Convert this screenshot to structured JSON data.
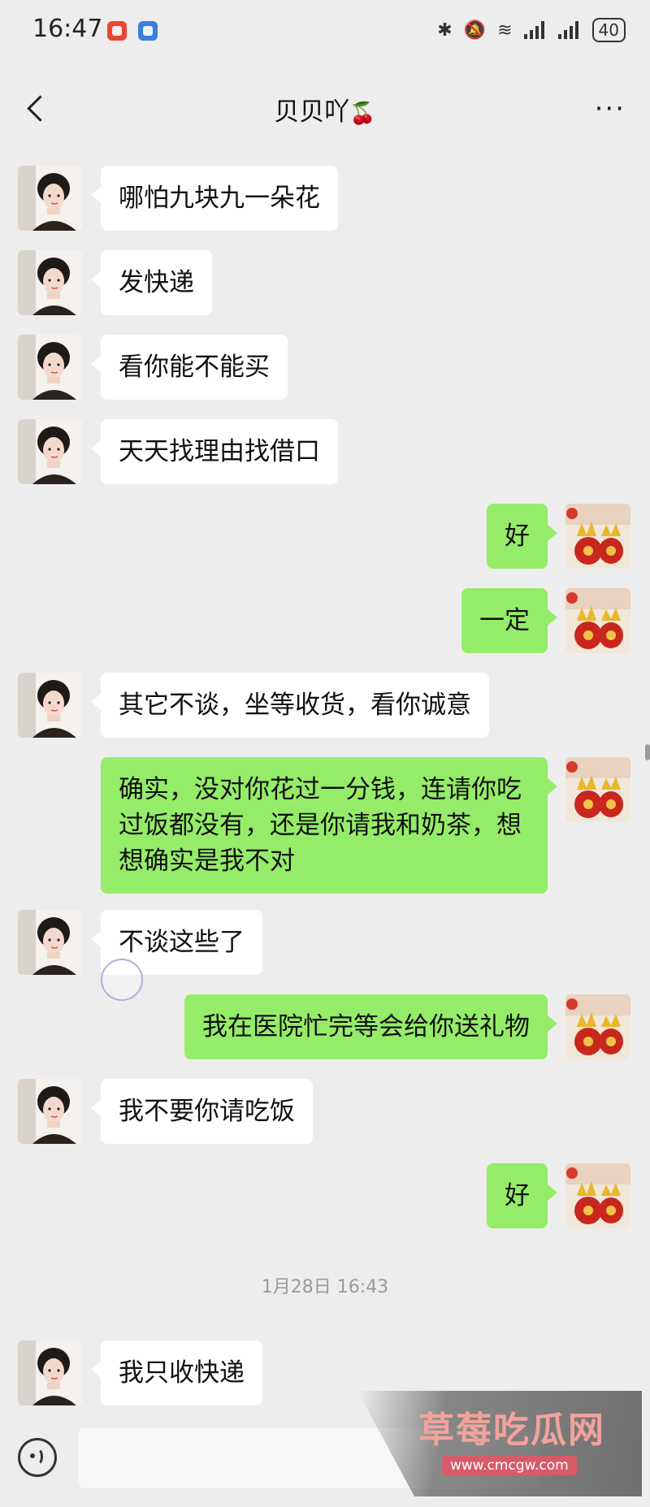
{
  "status_bar": {
    "time": "16:47",
    "battery": "40"
  },
  "header": {
    "title": "贝贝吖",
    "title_emoji": "🍒",
    "more_label": "···"
  },
  "messages": [
    {
      "from": "her",
      "text": "哪怕九块九一朵花"
    },
    {
      "from": "her",
      "text": "发快递"
    },
    {
      "from": "her",
      "text": "看你能不能买"
    },
    {
      "from": "her",
      "text": "天天找理由找借口"
    },
    {
      "from": "me",
      "text": "好"
    },
    {
      "from": "me",
      "text": "一定"
    },
    {
      "from": "her",
      "text": "其它不谈，坐等收货，看你诚意"
    },
    {
      "from": "me",
      "text": "确实，没对你花过一分钱，连请你吃过饭都没有，还是你请我和奶茶，想想确实是我不对"
    },
    {
      "from": "her",
      "text": "不谈这些了"
    },
    {
      "from": "me",
      "text": "我在医院忙完等会给你送礼物"
    },
    {
      "from": "her",
      "text": "我不要你请吃饭"
    },
    {
      "from": "me",
      "text": "好"
    },
    {
      "from": "her",
      "text": "我只收快递"
    }
  ],
  "timestamp": "1月28日 16:43",
  "watermark": {
    "title": "草莓吃瓜网",
    "url": "www.cmcgw.com"
  },
  "colors": {
    "background": "#ededed",
    "incoming_bubble": "#ffffff",
    "outgoing_bubble": "#95ec69"
  }
}
